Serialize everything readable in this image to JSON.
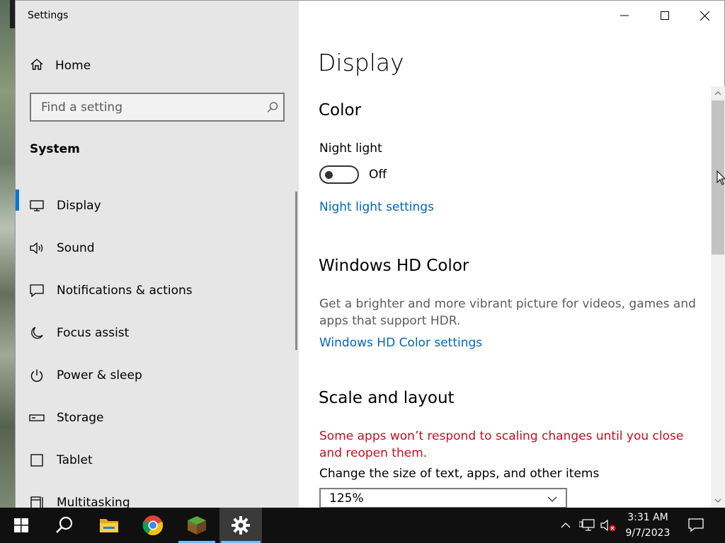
{
  "window": {
    "title": "Settings",
    "controls": {
      "minimize": "minimize",
      "maximize": "maximize",
      "close": "close"
    }
  },
  "sidebar": {
    "home_label": "Home",
    "search_placeholder": "Find a setting",
    "section_title": "System",
    "items": [
      {
        "label": "Display",
        "icon": "monitor-icon",
        "active": true
      },
      {
        "label": "Sound",
        "icon": "speaker-icon"
      },
      {
        "label": "Notifications & actions",
        "icon": "notification-icon"
      },
      {
        "label": "Focus assist",
        "icon": "moon-icon"
      },
      {
        "label": "Power & sleep",
        "icon": "power-icon"
      },
      {
        "label": "Storage",
        "icon": "storage-icon"
      },
      {
        "label": "Tablet",
        "icon": "tablet-icon"
      },
      {
        "label": "Multitasking",
        "icon": "multitasking-icon"
      }
    ]
  },
  "main": {
    "page_title": "Display",
    "color": {
      "heading": "Color",
      "night_light_label": "Night light",
      "night_light_state": "Off",
      "night_light_link": "Night light settings"
    },
    "hd_color": {
      "heading": "Windows HD Color",
      "description": "Get a brighter and more vibrant picture for videos, games and apps that support HDR.",
      "link": "Windows HD Color settings"
    },
    "scale": {
      "heading": "Scale and layout",
      "warning": "Some apps won’t respond to scaling changes until you close and reopen them.",
      "size_label": "Change the size of text, apps, and other items",
      "size_value": "125%"
    }
  },
  "taskbar": {
    "apps": [
      "start-icon",
      "search-icon",
      "file-explorer-icon",
      "chrome-icon",
      "minecraft-icon",
      "settings-gear-icon"
    ],
    "time": "3:31 AM",
    "date": "9/7/2023"
  },
  "colors": {
    "accent": "#0067b8",
    "selection_bar": "#0078d7",
    "warning": "#c50f1f",
    "sidebar_bg": "#e6e6e6"
  }
}
